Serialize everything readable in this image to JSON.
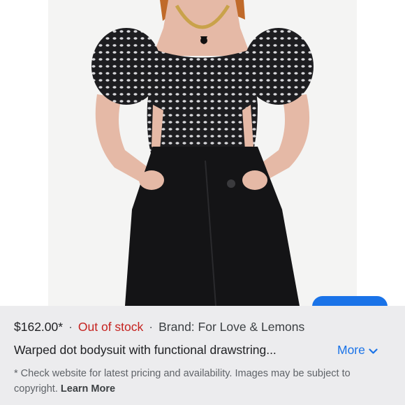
{
  "product": {
    "price": "$162.00*",
    "separator": "·",
    "stock_status": "Out of stock",
    "brand": "Brand: For Love & Lemons",
    "title": "Warped dot bodysuit with functional drawstring...",
    "more_label": "More"
  },
  "footer": {
    "disclaimer": "* Check website for latest pricing and availability. Images may be subject to copyright.",
    "learn_more_label": "Learn More"
  },
  "colors": {
    "accent_blue": "#1a73e8",
    "out_of_stock_red": "#c5221f",
    "panel_background": "#ececee"
  },
  "icons": {
    "more": "chevron-down-icon"
  }
}
